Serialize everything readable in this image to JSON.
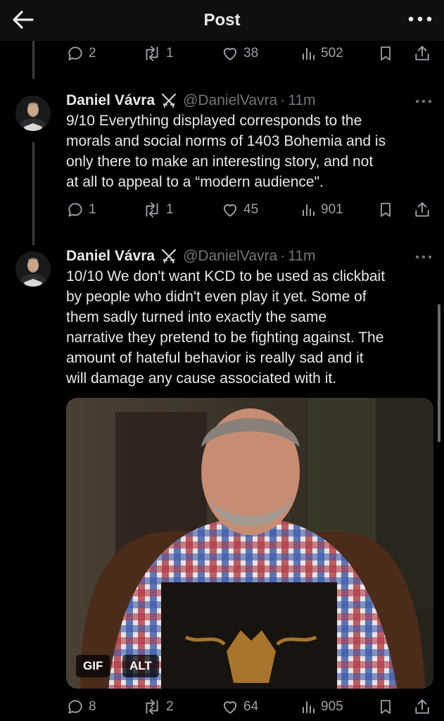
{
  "header": {
    "title": "Post",
    "back_icon": "arrow-left-icon",
    "more_icon": "more-horizontal-icon"
  },
  "colors": {
    "background": "#000000",
    "text": "#e7e9ea",
    "muted": "#71767b",
    "header_bg": "#0f0f0f"
  },
  "top_actions": {
    "replies": "2",
    "reposts": "1",
    "likes": "38",
    "views": "502"
  },
  "tweets": [
    {
      "name": "Daniel Vávra",
      "handle": "@DanielVavra",
      "separator": "·",
      "time": "11m",
      "lines": [
        "9/10 Everything displayed corresponds to the",
        "morals and social norms of 1403 Bohemia and is",
        "only there to make an interesting story, and not",
        "at all to appeal to a “modern audience\"."
      ],
      "actions": {
        "replies": "1",
        "reposts": "1",
        "likes": "45",
        "views": "901"
      }
    },
    {
      "name": "Daniel Vávra",
      "handle": "@DanielVavra",
      "separator": "·",
      "time": "11m",
      "lines": [
        "10/10 We don't want KCD to be used as clickbait",
        "by people who didn't even play it yet. Some of",
        "them sadly turned into exactly the same",
        "narrative they pretend to be fighting against. The",
        "amount of hateful behavior is really sad and it",
        "will damage any cause associated with it."
      ],
      "media": {
        "gif_label": "GIF",
        "alt_label": "ALT"
      },
      "actions": {
        "replies": "8",
        "reposts": "2",
        "likes": "64",
        "views": "905"
      }
    }
  ]
}
